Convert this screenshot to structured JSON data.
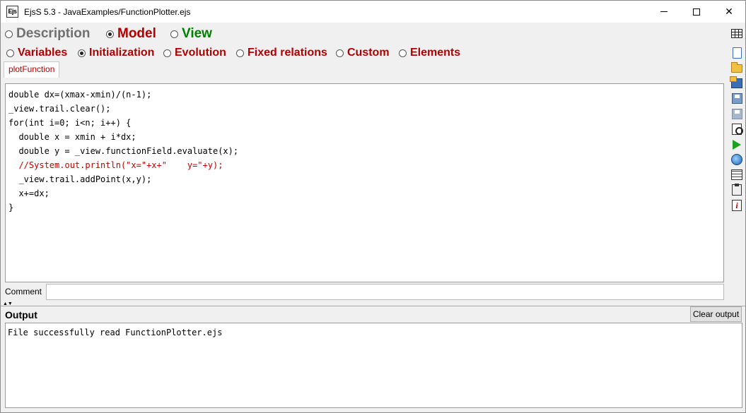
{
  "window": {
    "app_icon_text": "Ejs",
    "title": "EjsS 5.3 - JavaExamples/FunctionPlotter.ejs"
  },
  "main_tabs": [
    {
      "label": "Description",
      "selected": false,
      "color": "#707070"
    },
    {
      "label": "Model",
      "selected": true,
      "color": "#b00000"
    },
    {
      "label": "View",
      "selected": false,
      "color": "#008000"
    }
  ],
  "sub_tabs": [
    {
      "label": "Variables",
      "selected": false
    },
    {
      "label": "Initialization",
      "selected": true
    },
    {
      "label": "Evolution",
      "selected": false
    },
    {
      "label": "Fixed relations",
      "selected": false
    },
    {
      "label": "Custom",
      "selected": false
    },
    {
      "label": "Elements",
      "selected": false
    }
  ],
  "page_tab": {
    "label": "plotFunction"
  },
  "code": {
    "lines": [
      {
        "text": "double dx=(xmax-xmin)/(n-1);",
        "color": "#000000"
      },
      {
        "text": "_view.trail.clear();",
        "color": "#000000"
      },
      {
        "text": "for(int i=0; i<n; i++) {",
        "color": "#000000"
      },
      {
        "text": "  double x = xmin + i*dx;",
        "color": "#000000"
      },
      {
        "text": "  double y = _view.functionField.evaluate(x);",
        "color": "#000000"
      },
      {
        "text": "  //System.out.println(\"x=\"+x+\"    y=\"+y);",
        "color": "#c00000"
      },
      {
        "text": "  _view.trail.addPoint(x,y);",
        "color": "#000000"
      },
      {
        "text": "  x+=dx;",
        "color": "#000000"
      },
      {
        "text": "}",
        "color": "#000000"
      }
    ]
  },
  "comment": {
    "label": "Comment",
    "value": ""
  },
  "output": {
    "title": "Output",
    "clear_label": "Clear output",
    "text": "File successfully read FunctionPlotter.ejs"
  },
  "toolbar": {
    "icons": [
      "new-file-icon",
      "open-folder-icon",
      "open-simulation-icon",
      "save-icon",
      "save-as-icon",
      "search-icon",
      "run-icon",
      "web-icon",
      "layers-icon",
      "options-icon",
      "info-icon"
    ]
  }
}
